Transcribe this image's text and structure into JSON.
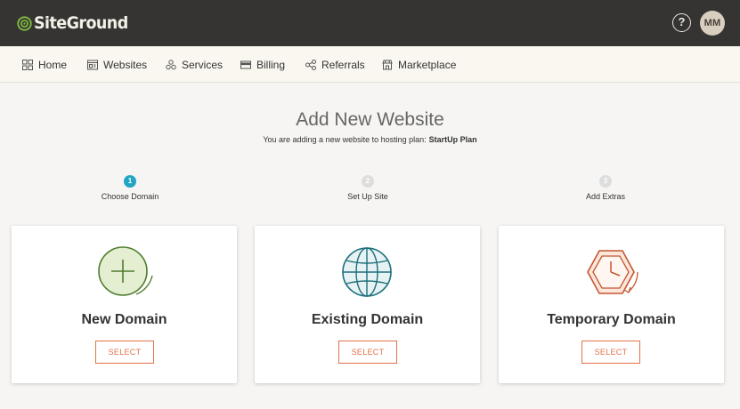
{
  "header": {
    "logo_text": "SiteGround",
    "help_label": "?",
    "avatar_initials": "MM"
  },
  "nav": {
    "items": [
      {
        "label": "Home",
        "icon": "grid-icon"
      },
      {
        "label": "Websites",
        "icon": "window-icon"
      },
      {
        "label": "Services",
        "icon": "services-icon"
      },
      {
        "label": "Billing",
        "icon": "card-icon"
      },
      {
        "label": "Referrals",
        "icon": "share-icon"
      },
      {
        "label": "Marketplace",
        "icon": "store-icon"
      }
    ]
  },
  "page": {
    "title": "Add New Website",
    "subtitle": "You are adding a new website to hosting plan:",
    "plan_name": "StartUp Plan"
  },
  "steps": [
    {
      "number": "1",
      "label": "Choose Domain",
      "active": true
    },
    {
      "number": "2",
      "label": "Set Up Site",
      "active": false
    },
    {
      "number": "3",
      "label": "Add Extras",
      "active": false
    }
  ],
  "cards": [
    {
      "title": "New Domain",
      "button": "SELECT",
      "icon": "plus-circle-icon"
    },
    {
      "title": "Existing Domain",
      "button": "SELECT",
      "icon": "globe-icon"
    },
    {
      "title": "Temporary Domain",
      "button": "SELECT",
      "icon": "clock-hexagon-icon"
    }
  ],
  "colors": {
    "topbar": "#363432",
    "nav_bg": "#f9f7ef",
    "accent_orange": "#e0714a",
    "step_active": "#22a4c4",
    "green_icon": "#4e7d2e",
    "teal_icon": "#1d6f7c",
    "orange_icon": "#c4562e"
  }
}
